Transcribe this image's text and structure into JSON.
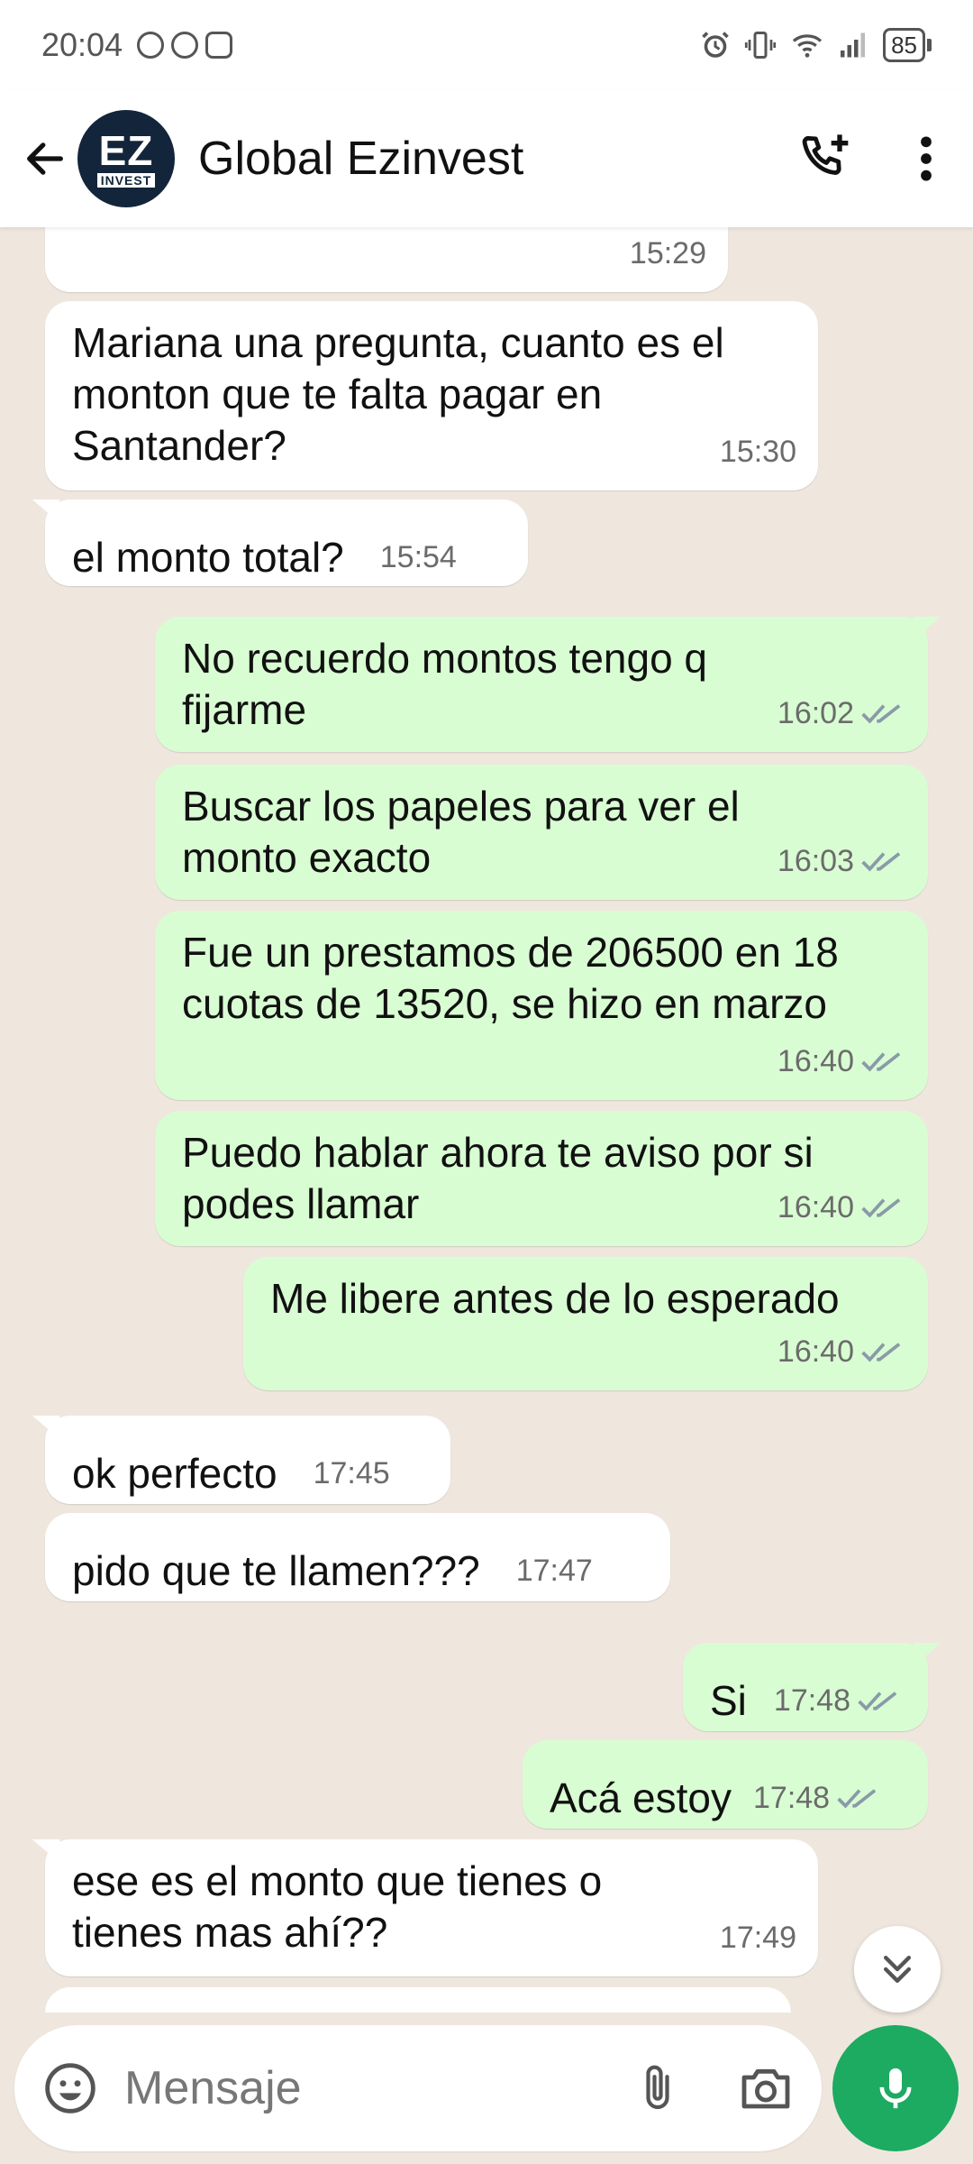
{
  "status_bar": {
    "time": "20:04",
    "battery": "85",
    "notif_icons": [
      "whatsapp-icon",
      "whatsapp-icon",
      "instagram-icon"
    ],
    "system_icons": [
      "alarm-icon",
      "vibrate-icon",
      "wifi-icon",
      "signal-icon",
      "battery-icon"
    ]
  },
  "header": {
    "contact_name": "Global Ezinvest",
    "avatar_text_top": "EZ",
    "avatar_text_bottom": "INVEST",
    "icons": [
      "back-arrow-icon",
      "add-call-icon",
      "more-vert-icon"
    ]
  },
  "messages": [
    {
      "dir": "in",
      "text": "",
      "time": "15:29"
    },
    {
      "dir": "in",
      "text": "Mariana una pregunta, cuanto es el monton que te falta pagar en Santander?",
      "time": "15:30"
    },
    {
      "dir": "in",
      "text": "el monto total?",
      "time": "15:54"
    },
    {
      "dir": "out",
      "text": "No recuerdo montos tengo q fijarme",
      "time": "16:02"
    },
    {
      "dir": "out",
      "text": "Buscar los papeles para ver el monto exacto",
      "time": "16:03"
    },
    {
      "dir": "out",
      "text": "Fue un prestamos de 206500 en 18 cuotas de 13520, se hizo en marzo",
      "time": "16:40"
    },
    {
      "dir": "out",
      "text": "Puedo hablar ahora te aviso por si podes llamar",
      "time": "16:40"
    },
    {
      "dir": "out",
      "text": "Me libere antes de lo esperado",
      "time": "16:40"
    },
    {
      "dir": "in",
      "text": "ok perfecto",
      "time": "17:45"
    },
    {
      "dir": "in",
      "text": "pido que te llamen???",
      "time": "17:47"
    },
    {
      "dir": "out",
      "text": "Si",
      "time": "17:48"
    },
    {
      "dir": "out",
      "text": "Acá estoy",
      "time": "17:48"
    },
    {
      "dir": "in",
      "text": "ese es el monto que tienes o tienes mas ahí??",
      "time": "17:49"
    }
  ],
  "composer": {
    "placeholder": "Mensaje",
    "icons": [
      "emoji-icon",
      "attach-icon",
      "camera-icon",
      "mic-icon"
    ]
  },
  "colors": {
    "chat_bg": "#efe7de",
    "incoming_bubble": "#ffffff",
    "outgoing_bubble": "#d9fdd3",
    "accent": "#1daa61",
    "read_ticks": "#8a9aa8"
  }
}
